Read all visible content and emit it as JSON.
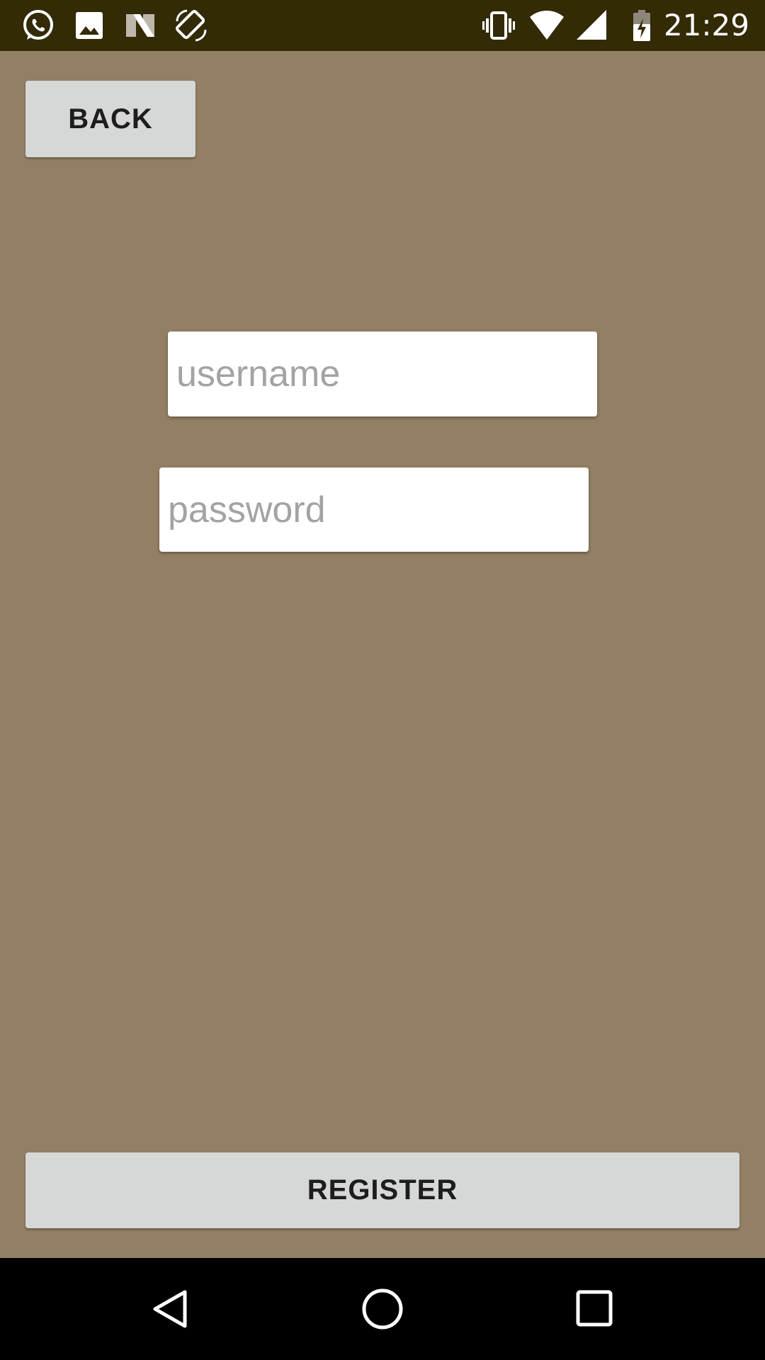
{
  "status_bar": {
    "time": "21:29",
    "left_icons": [
      "whatsapp-icon",
      "gallery-icon",
      "n-logo-icon",
      "screen-rotation-icon"
    ],
    "right_icons": [
      "vibrate-icon",
      "wifi-icon",
      "cellular-signal-icon",
      "battery-charging-icon"
    ]
  },
  "header": {
    "back_label": "BACK"
  },
  "form": {
    "username_placeholder": "username",
    "username_value": "",
    "password_placeholder": "password",
    "password_value": ""
  },
  "footer": {
    "register_label": "REGISTER"
  },
  "navigation_bar": {
    "buttons": [
      "nav-back-icon",
      "nav-home-icon",
      "nav-recents-icon"
    ]
  },
  "colors": {
    "background": "#938064",
    "status_bar": "#332a06",
    "button": "#d6d7d7",
    "nav_bar": "#000000"
  }
}
